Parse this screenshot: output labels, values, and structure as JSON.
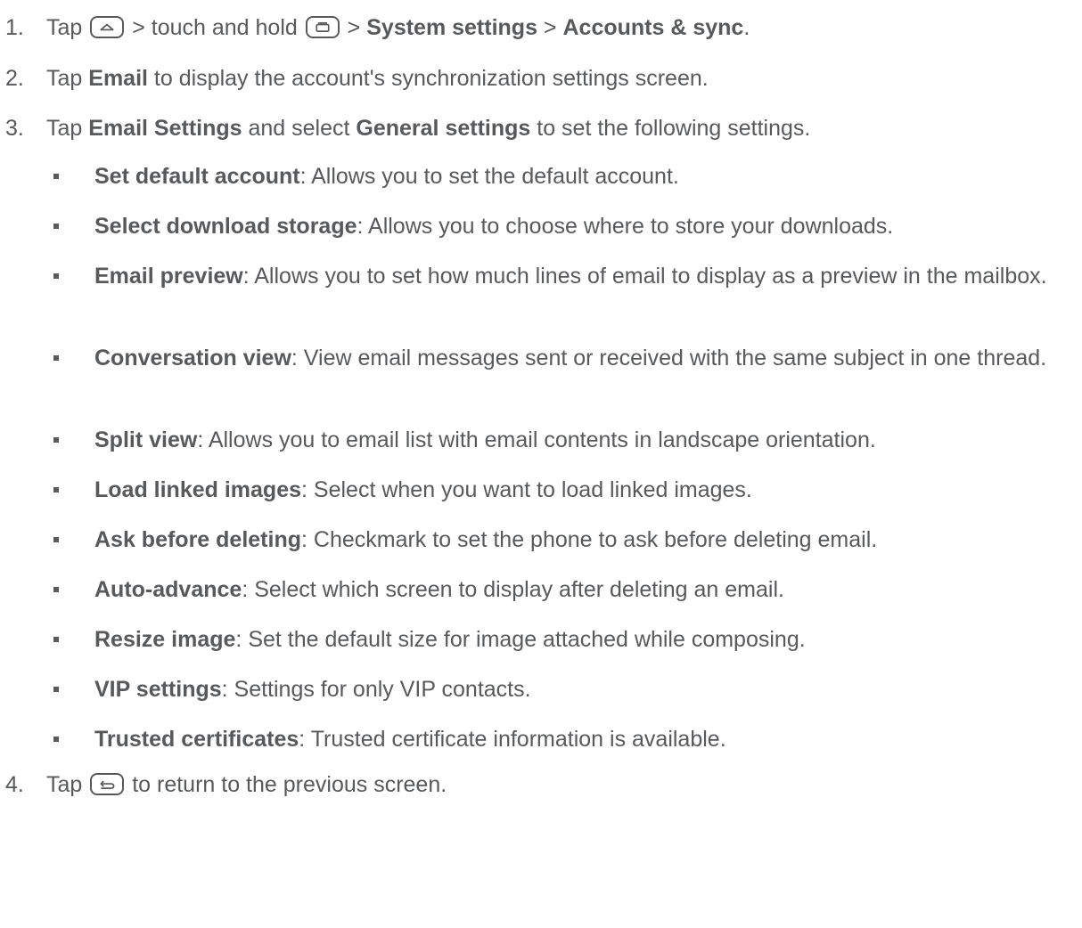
{
  "steps": [
    {
      "num": "1.",
      "parts": {
        "tap": "Tap",
        "mid": " > touch and hold ",
        "sep1": " > ",
        "b1": "System settings",
        "sep2": " > ",
        "b2": "Accounts & sync",
        "end": "."
      },
      "icons": [
        "home-key-icon",
        "recent-apps-key-icon"
      ]
    },
    {
      "num": "2.",
      "parts": {
        "tap": "Tap ",
        "b1": "Email",
        "rest": " to display the account's synchronization settings screen."
      }
    },
    {
      "num": "3.",
      "parts": {
        "tap": "Tap ",
        "b1": "Email Settings",
        "mid": " and select ",
        "b2": "General settings",
        "rest": " to set the following settings."
      }
    },
    {
      "num": "4.",
      "parts": {
        "tap": "Tap ",
        "rest": " to return to the previous screen."
      },
      "icons": [
        "back-key-icon"
      ]
    }
  ],
  "settings": [
    {
      "term": "Set default account",
      "desc": ": Allows you to set the default account."
    },
    {
      "term": "Select download storage",
      "desc": ": Allows you to choose where to store your downloads."
    },
    {
      "term": "Email preview",
      "desc": ": Allows you to set how much lines of email to display as a preview in the mailbox."
    },
    {
      "term": "Conversation view",
      "desc": ": View email messages sent or received with the same subject in one thread."
    },
    {
      "term": "Split view",
      "desc": ": Allows you to email list with email contents in landscape orientation."
    },
    {
      "term": "Load linked images",
      "desc": ": Select when you want to load linked images."
    },
    {
      "term": "Ask before deleting",
      "desc": ": Checkmark to set the phone to ask before deleting email."
    },
    {
      "term": "Auto-advance",
      "desc": ": Select which screen to display after deleting an email."
    },
    {
      "term": "Resize image",
      "desc": ": Set the default size for image attached while composing."
    },
    {
      "term": "VIP settings",
      "desc": ": Settings for only VIP contacts."
    },
    {
      "term": "Trusted certificates",
      "desc": ": Trusted certificate information is available."
    }
  ],
  "colors": {
    "text": "#58595b",
    "background": "#ffffff"
  }
}
